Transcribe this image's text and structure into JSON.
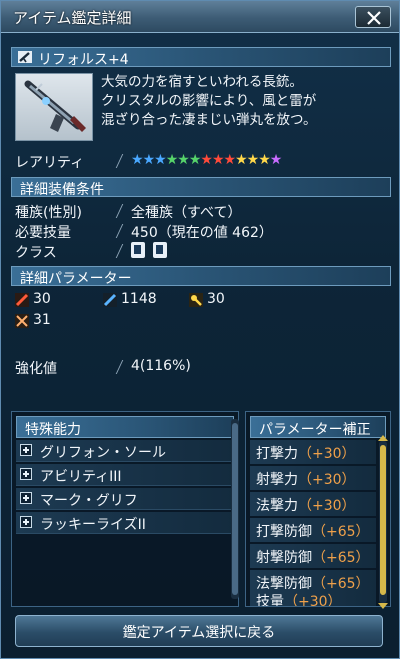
{
  "window": {
    "title": "アイテム鑑定詳細"
  },
  "item": {
    "name": "リフォルス+4",
    "description": [
      "大気の力を宿すといわれる長銃。",
      "クリスタルの影響により、風と雷が",
      "混ざり合った凄まじい弾丸を放つ。"
    ]
  },
  "rarity": {
    "label": "レアリティ",
    "stars": [
      "#4aa8ff",
      "#4aa8ff",
      "#4aa8ff",
      "#56d36a",
      "#56d36a",
      "#56d36a",
      "#ff4a3a",
      "#ff4a3a",
      "#ff4a3a",
      "#ffd84a",
      "#ffd84a",
      "#ffd84a",
      "#c86cff"
    ]
  },
  "requirements": {
    "header": "詳細装備条件",
    "race_label": "種族(性別)",
    "race_value": "全種族（すべて）",
    "skill_label": "必要技量",
    "skill_value": "450（現在の値 462）",
    "class_label": "クラス"
  },
  "params": {
    "header": "詳細パラメーター",
    "strike": "30",
    "range": "1148",
    "tech": "30",
    "dex": "31"
  },
  "enhance": {
    "label": "強化値",
    "value": "4(116%)"
  },
  "abilities": {
    "header": "特殊能力",
    "items": [
      "グリフォン・ソール",
      "アビリティIII",
      "マーク・グリフ",
      "ラッキーライズII"
    ]
  },
  "bonuses": {
    "header": "パラメーター補正",
    "items": [
      {
        "name": "打撃力",
        "value": "（+30）"
      },
      {
        "name": "射撃力",
        "value": "（+30）"
      },
      {
        "name": "法撃力",
        "value": "（+30）"
      },
      {
        "name": "打撃防御",
        "value": "（+65）"
      },
      {
        "name": "射撃防御",
        "value": "（+65）"
      },
      {
        "name": "法撃防御",
        "value": "（+65）"
      },
      {
        "name": "技量",
        "value": "（+30）"
      }
    ]
  },
  "footer": {
    "back_button": "鑑定アイテム選択に戻る"
  },
  "colors": {
    "accent": "#f0a14a",
    "scroll": "#d6b84a"
  }
}
